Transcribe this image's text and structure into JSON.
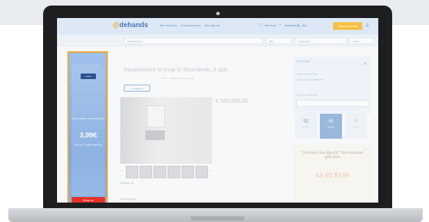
{
  "header": {
    "logo_mark": "@",
    "logo_text": "dehands",
    "links": [
      "Alle rubrieken",
      "Zoekopdrachten",
      "Mijn Agenda"
    ],
    "icons": [
      "heart-icon",
      "bell-icon",
      "user-icon"
    ],
    "actions": [
      "Berichten",
      "Meldingen",
      "Mijn"
    ],
    "place_ad": "Plaats zoekertje",
    "account_icon": "☰"
  },
  "search": {
    "placeholder": "Wat zoek je?",
    "category": "Alle",
    "location": "Postcode",
    "submit": "Zoek"
  },
  "ad_banner": {
    "brand": "Lutece",
    "line1": "Extra sterkte vuilniszakken",
    "price": "3,99€",
    "line2": "Per rol. Gratis levering",
    "cta": "Shop nu"
  },
  "listing": {
    "title": "Appartement te koop in Strombeek, 3 slpk.",
    "subtitle": "2 km  ·  Geplaatst vandaag",
    "message_button": "Bericht",
    "price": "€ 340.000,00",
    "save_link": "Bewaar dit",
    "description_heading": "Beschrijving"
  },
  "seller": {
    "label": "Verkoper",
    "line1": "Actief sinds 5 jaar",
    "line2": "Telefoon beschikbaar",
    "line3": "E-mail ontvangen",
    "contact_options": [
      {
        "label": "Oproep",
        "icon": "☎"
      },
      {
        "label": "Bericht",
        "icon": "✉"
      },
      {
        "label": "Delen",
        "icon": "✎"
      }
    ]
  },
  "promo": {
    "title": "\"Around the World\" two-drawer gift box",
    "price": "44,92 EUR"
  },
  "colors": {
    "accent": "#f2a62a",
    "header_bg": "#dce8f6",
    "ad_cta": "#e8312b"
  }
}
